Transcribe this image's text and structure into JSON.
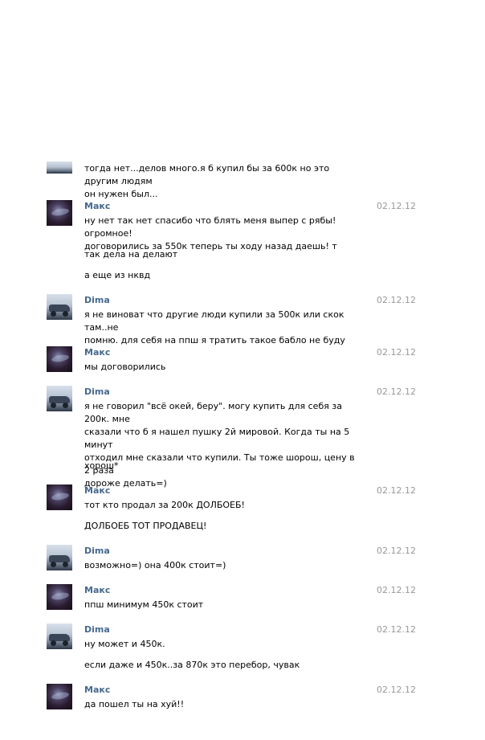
{
  "users": {
    "maks": {
      "name": "Макс",
      "avatar": "avatar-maks"
    },
    "dima": {
      "name": "Dima",
      "avatar": "avatar-dima"
    }
  },
  "messages": [
    {
      "author": "dima",
      "time": "",
      "lines": [
        "тогда нет...делов много.я б купил бы за 600к но это другим людям",
        "он нужен был..."
      ]
    },
    {
      "author": "maks",
      "time": "02.12.12",
      "lines": [
        "ну нет так нет спасибо что блять меня выпер с рябы! огромное!",
        "договорились за 550к теперь ты ходу назад даешь! т"
      ]
    },
    {
      "author": "maks",
      "time": "",
      "lines": [
        "так дела на делают"
      ]
    },
    {
      "author": "maks",
      "time": "",
      "lines": [
        "а еще из нквд"
      ]
    },
    {
      "author": "dima",
      "time": "02.12.12",
      "lines": [
        "я не виноват что другие люди купили за 500к или скок там..не",
        "помню. для себя на ппш я тратить такое бабло не буду"
      ]
    },
    {
      "author": "maks",
      "time": "02.12.12",
      "lines": [
        "мы договорились"
      ]
    },
    {
      "author": "dima",
      "time": "02.12.12",
      "lines": [
        "я не говорил \"всё окей, беру\". могу купить для себя за 200к. мне",
        "сказали что б я нашел пушку 2й мировой. Когда ты на 5 минут",
        "отходил мне сказали что купили. Ты тоже шорош, цену в 2 раза",
        "дороже делать=)"
      ]
    },
    {
      "author": "dima",
      "time": "",
      "lines": [
        "хорош*"
      ]
    },
    {
      "author": "maks",
      "time": "02.12.12",
      "lines": [
        "тот кто продал за 200к ДОЛБОЕБ!"
      ]
    },
    {
      "author": "maks",
      "time": "",
      "lines": [
        "ДОЛБОЕБ ТОТ ПРОДАВЕЦ!"
      ]
    },
    {
      "author": "dima",
      "time": "02.12.12",
      "lines": [
        "возможно=) она 400к стоит=)"
      ]
    },
    {
      "author": "maks",
      "time": "02.12.12",
      "lines": [
        "ппш минимум 450к стоит"
      ]
    },
    {
      "author": "dima",
      "time": "02.12.12",
      "lines": [
        "ну может и 450к."
      ]
    },
    {
      "author": "dima",
      "time": "",
      "lines": [
        "если даже и 450к..за 870к это перебор, чувак"
      ]
    },
    {
      "author": "maks",
      "time": "02.12.12",
      "lines": [
        "да пошел ты на хуй!!"
      ]
    }
  ]
}
